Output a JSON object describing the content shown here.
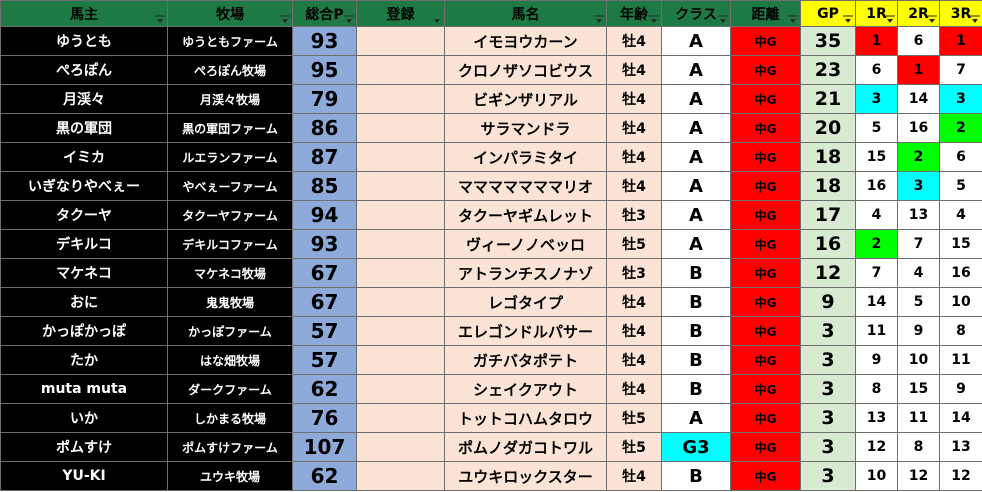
{
  "headers": {
    "owner": "馬主",
    "farm": "牧場",
    "total": "総合P",
    "register": "登録",
    "horse": "馬名",
    "age": "年齢",
    "class": "クラス",
    "distance": "距離",
    "gp": "GP",
    "r1": "1R",
    "r2": "2R",
    "r3": "3R"
  },
  "colors": {
    "header_bg": "#1e7a45",
    "gp_header_bg": "#ffff00",
    "owner_bg": "#000000",
    "total_bg": "#8eaadb",
    "horse_bg": "#fbe4d5",
    "distance_bg": "#ff0000",
    "gp_bg": "#d9ead3",
    "g3_bg": "#00ffff",
    "first_place": "#ff0000",
    "second_place": "#00ff00",
    "third_place": "#00ffff"
  },
  "rows": [
    {
      "owner": "ゆうとも",
      "farm": "ゆうともファーム",
      "total": "93",
      "register": "",
      "horse": "イモヨウカーン",
      "age": "牡4",
      "class": "A",
      "distance": "中G",
      "gp": "35",
      "r1": "1",
      "r2": "6",
      "r3": "1"
    },
    {
      "owner": "ぺろぽん",
      "farm": "ぺろぽん牧場",
      "total": "95",
      "register": "",
      "horse": "クロノザソコビウス",
      "age": "牡4",
      "class": "A",
      "distance": "中G",
      "gp": "23",
      "r1": "6",
      "r2": "1",
      "r3": "7"
    },
    {
      "owner": "月渓々",
      "farm": "月渓々牧場",
      "total": "79",
      "register": "",
      "horse": "ビギンザリアル",
      "age": "牡4",
      "class": "A",
      "distance": "中G",
      "gp": "21",
      "r1": "3",
      "r2": "14",
      "r3": "3"
    },
    {
      "owner": "黒の軍団",
      "farm": "黒の軍団ファーム",
      "total": "86",
      "register": "",
      "horse": "サラマンドラ",
      "age": "牡4",
      "class": "A",
      "distance": "中G",
      "gp": "20",
      "r1": "5",
      "r2": "16",
      "r3": "2"
    },
    {
      "owner": "イミカ",
      "farm": "ルエランファーム",
      "total": "87",
      "register": "",
      "horse": "インパラミタイ",
      "age": "牡4",
      "class": "A",
      "distance": "中G",
      "gp": "18",
      "r1": "15",
      "r2": "2",
      "r3": "6"
    },
    {
      "owner": "いぎなりやべぇー",
      "farm": "やべぇーファーム",
      "total": "85",
      "register": "",
      "horse": "マママママママリオ",
      "age": "牡4",
      "class": "A",
      "distance": "中G",
      "gp": "18",
      "r1": "16",
      "r2": "3",
      "r3": "5"
    },
    {
      "owner": "タクーヤ",
      "farm": "タクーヤファーム",
      "total": "94",
      "register": "",
      "horse": "タクーヤギムレット",
      "age": "牡3",
      "class": "A",
      "distance": "中G",
      "gp": "17",
      "r1": "4",
      "r2": "13",
      "r3": "4"
    },
    {
      "owner": "デキルコ",
      "farm": "デキルコファーム",
      "total": "93",
      "register": "",
      "horse": "ヴィーノノベッロ",
      "age": "牡5",
      "class": "A",
      "distance": "中G",
      "gp": "16",
      "r1": "2",
      "r2": "7",
      "r3": "15"
    },
    {
      "owner": "マケネコ",
      "farm": "マケネコ牧場",
      "total": "67",
      "register": "",
      "horse": "アトランチスノナゾ",
      "age": "牡3",
      "class": "B",
      "distance": "中G",
      "gp": "12",
      "r1": "7",
      "r2": "4",
      "r3": "16"
    },
    {
      "owner": "おに",
      "farm": "鬼鬼牧場",
      "total": "67",
      "register": "",
      "horse": "レゴタイプ",
      "age": "牡4",
      "class": "B",
      "distance": "中G",
      "gp": "9",
      "r1": "14",
      "r2": "5",
      "r3": "10"
    },
    {
      "owner": "かっぽかっぽ",
      "farm": "かっぽファーム",
      "total": "57",
      "register": "",
      "horse": "エレゴンドルパサー",
      "age": "牡4",
      "class": "B",
      "distance": "中G",
      "gp": "3",
      "r1": "11",
      "r2": "9",
      "r3": "8"
    },
    {
      "owner": "たか",
      "farm": "はな畑牧場",
      "total": "57",
      "register": "",
      "horse": "ガチバタポテト",
      "age": "牡4",
      "class": "B",
      "distance": "中G",
      "gp": "3",
      "r1": "9",
      "r2": "10",
      "r3": "11"
    },
    {
      "owner": "muta muta",
      "farm": "ダークファーム",
      "total": "62",
      "register": "",
      "horse": "シェイクアウト",
      "age": "牡4",
      "class": "B",
      "distance": "中G",
      "gp": "3",
      "r1": "8",
      "r2": "15",
      "r3": "9"
    },
    {
      "owner": "いか",
      "farm": "しかまる牧場",
      "total": "76",
      "register": "",
      "horse": "トットコハムタロウ",
      "age": "牡5",
      "class": "A",
      "distance": "中G",
      "gp": "3",
      "r1": "13",
      "r2": "11",
      "r3": "14"
    },
    {
      "owner": "ポムすけ",
      "farm": "ポムすけファーム",
      "total": "107",
      "register": "",
      "horse": "ポムノダガコトワル",
      "age": "牡5",
      "class": "G3",
      "distance": "中G",
      "gp": "3",
      "r1": "12",
      "r2": "8",
      "r3": "13"
    },
    {
      "owner": "YU-KI",
      "farm": "ユウキ牧場",
      "total": "62",
      "register": "",
      "horse": "ユウキロックスター",
      "age": "牡4",
      "class": "B",
      "distance": "中G",
      "gp": "3",
      "r1": "10",
      "r2": "12",
      "r3": "12"
    }
  ]
}
